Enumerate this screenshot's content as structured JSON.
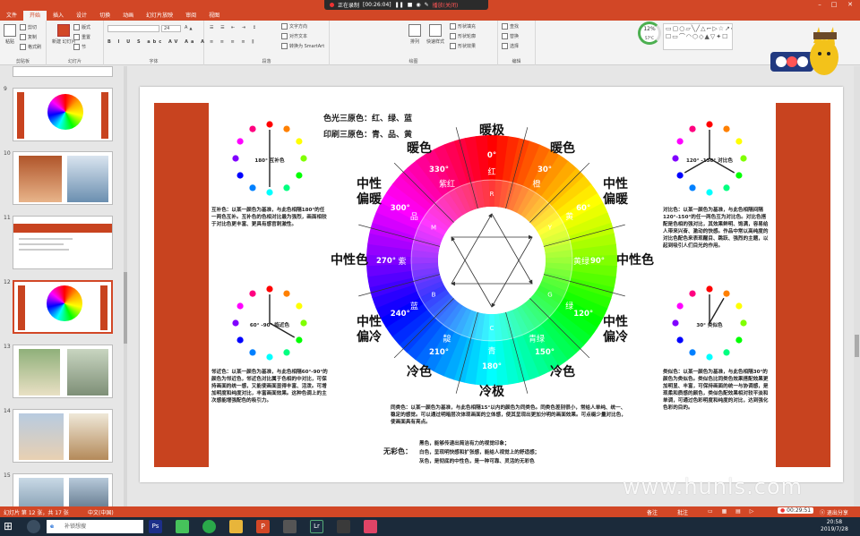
{
  "recording": {
    "status": "正在录制",
    "time": "[00:26:04]",
    "status_right": "播放(关闭)"
  },
  "window": {
    "login": "登录",
    "min": "–",
    "max": "□",
    "close": "✕"
  },
  "tabs": [
    "文件",
    "开始",
    "插入",
    "设计",
    "切换",
    "动画",
    "幻灯片放映",
    "审阅",
    "视图"
  ],
  "ribbon": {
    "paste": "粘贴",
    "cut": "剪切",
    "copy": "复制",
    "format_painter": "格式刷",
    "clipboard": "剪贴板",
    "new_slide": "新建\n幻灯片",
    "layout": "版式",
    "reset": "重置",
    "section": "节",
    "slides": "幻灯片",
    "font_size": "24",
    "font": "字体",
    "paragraph": "段落",
    "text_direction": "文字方向",
    "align_text": "对齐文本",
    "smartart": "转换为 SmartArt",
    "drawing": "绘图",
    "arrange": "排列",
    "quick_styles": "快速样式",
    "shape_fill": "形状填充",
    "shape_outline": "形状轮廓",
    "shape_effects": "形状效果",
    "find": "查找",
    "replace": "替换",
    "select": "选择",
    "editing": "编辑",
    "gauge_pct": "12%",
    "gauge_temp": "57°C"
  },
  "thumbnails": [
    "9",
    "10",
    "11",
    "12",
    "13",
    "14",
    "15"
  ],
  "slide": {
    "primaries_light": "色光三原色：红、绿、蓝",
    "primaries_print": "印刷三原色：青、品、黄",
    "warm_top": "暖极",
    "cold_bottom": "冷极",
    "warm_left": "暖色",
    "warm_right": "暖色",
    "neutral_warm_left": [
      "中性",
      "偏暖"
    ],
    "neutral_warm_right": [
      "中性",
      "偏暖"
    ],
    "neutral_left": "中性色",
    "neutral_right": "中性色",
    "neutral_cold_left": [
      "中性",
      "偏冷"
    ],
    "neutral_cold_right": [
      "中性",
      "偏冷"
    ],
    "cold_left": "冷色",
    "cold_right": "冷色",
    "deg_labels": [
      "0°",
      "30°",
      "60°",
      "90°",
      "120°",
      "150°",
      "180°",
      "210°",
      "240°",
      "270°",
      "300°",
      "330°"
    ],
    "color_names": [
      "红",
      "橙",
      "黄",
      "黄绿",
      "绿",
      "青绿",
      "青",
      "靛",
      "蓝",
      "紫",
      "品",
      "紫红"
    ],
    "inner_letters": [
      "R",
      "Y",
      "G",
      "C",
      "B",
      "M"
    ],
    "complement_caption": "180° 互补色",
    "complement_text": "互补色：以某一颜色为基准，与此色相隔180°的任一两色互补。互补色的色相对比最为强烈，画面相较于对比色更丰富、更具有感官刺激性。",
    "contrast_caption": "120° -150° 对比色",
    "contrast_text": "对比色：以某一颜色为基准，与此色相隔间隔120°-150°的任一两色互为对比色。对比色搭配是色相的强对比，其效果鲜明、饱满，容易给人带来兴奋、激动的快感。作品中常以高纯度的对比色配色来表现醒目、跳跃、强烈的主题，以起到吸引人们目光的作用。",
    "adjacent_caption": "60° -90° 临近色",
    "adjacent_text": "邻近色：以某一颜色为基准，与此色相隔60°-90°的颜色为邻近色，邻近色对比属于色相的中对比，可保持画面的统一感，又能使画面显得丰富、活泼。可增加明度和纯度对比，丰富画面效果。这种色调上的主次感能增强配色的吸引力。",
    "similar_caption": "30° 类似色",
    "similar_text": "类似色：以某一颜色为基准，与此色相隔30°的颜色为类似色。类似色比同类色效果搭配效果更加明显、丰富，可保持画面的统一与协调感，是现柔和质感的颜色，类似色配效果相对较平淡和单调，可通过色彩明度和纯度的对比，达到强化色彩的目的。",
    "same_text": "同类色：以某一颜色为基准，与此色相隔15°以内的颜色为同类色。同类色差别很小，常给人单纯、统一、稳定的感觉。可以通过明暗层次体现画面的立体感，使其呈现出更加分明的画面效果。可点缀少量对比色，使画面具有亮点。",
    "achromatic_title": "无彩色：",
    "achromatic_lines": [
      "黑色，能够传递出简洁有力的视觉印象；",
      "白色，呈现明快感和扩张感，能给人视觉上的舒适感；",
      "灰色，是彻底的中性色，是一种可靠、灵活的无彩色"
    ]
  },
  "statusbar": {
    "slide_info": "幻灯片 第 12 张，共 17 张",
    "lang": "中文(中国)",
    "notes": "备注",
    "comments": "批注",
    "zoom": "",
    "rec_time": "00:29:51",
    "exit_share": "退出分享"
  },
  "taskbar": {
    "search_placeholder": "补锁想搜",
    "search_btn": "搜索",
    "time": "20:58",
    "date": "2019/7/28"
  },
  "watermark": "www.hunls.com",
  "colors": {
    "accent": "#d24726",
    "slide_bar": "#c8431f"
  }
}
